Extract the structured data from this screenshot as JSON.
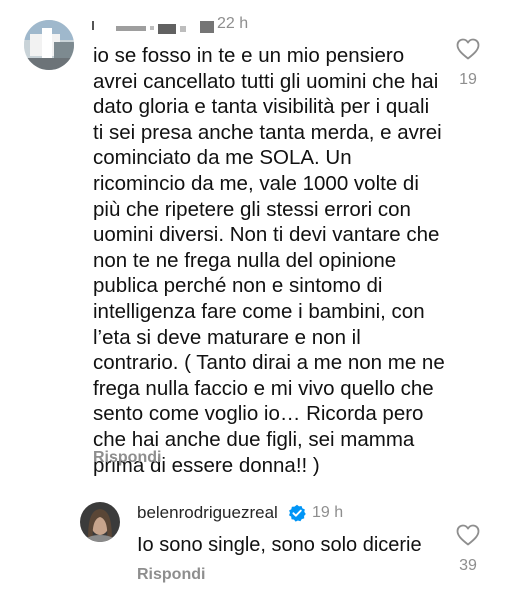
{
  "comments": [
    {
      "username": "",
      "time": "22 h",
      "text": "io se fosso in te e un mio pensiero\navrei cancellato tutti gli uomini che hai\ndato gloria e tanta visibilità per i quali\nti sei presa anche tanta merda, e avrei\ncominciato da me SOLA. Un\nricomincio da me, vale 1000 volte di\npiù che ripetere gli stessi errori con\nuomini diversi. Non ti devi vantare che\nnon te ne frega nulla del opinione\npublica perché non e sintomo di\nintelligenza fare come i bambini, con\nl’eta si deve maturare e non il\ncontrario. ( Tanto dirai a me non me ne\nfrega nulla faccio e mi vivo quello che\nsento come voglio io… Ricorda pero\nche hai anche due figli, sei mamma\nprima di essere donna!! )",
      "reply_label": "Rispondi",
      "likes": "19",
      "like_icon": "heart-outline-icon"
    },
    {
      "username": "belenrodriguezreal",
      "verified": true,
      "verified_color": "#0095f6",
      "time": "19 h",
      "text": "Io sono single, sono solo dicerie",
      "reply_label": "Rispondi",
      "likes": "39",
      "like_icon": "heart-outline-icon"
    }
  ]
}
